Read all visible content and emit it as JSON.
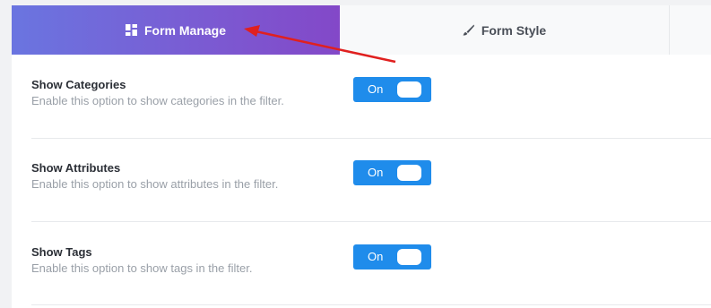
{
  "tabs": {
    "form_manage": {
      "label": "Form Manage",
      "icon": "dashboard-icon"
    },
    "form_style": {
      "label": "Form Style",
      "icon": "brush-icon"
    }
  },
  "settings": [
    {
      "title": "Show Categories",
      "description": "Enable this option to show categories in the filter.",
      "toggle": "On"
    },
    {
      "title": "Show Attributes",
      "description": "Enable this option to show attributes in the filter.",
      "toggle": "On"
    },
    {
      "title": "Show Tags",
      "description": "Enable this option to show tags in the filter.",
      "toggle": "On"
    }
  ],
  "colors": {
    "active_tab_start": "#6a75e0",
    "active_tab_end": "#8348c8",
    "toggle_on": "#1f8ceb",
    "annotation_arrow": "#e0201f"
  }
}
